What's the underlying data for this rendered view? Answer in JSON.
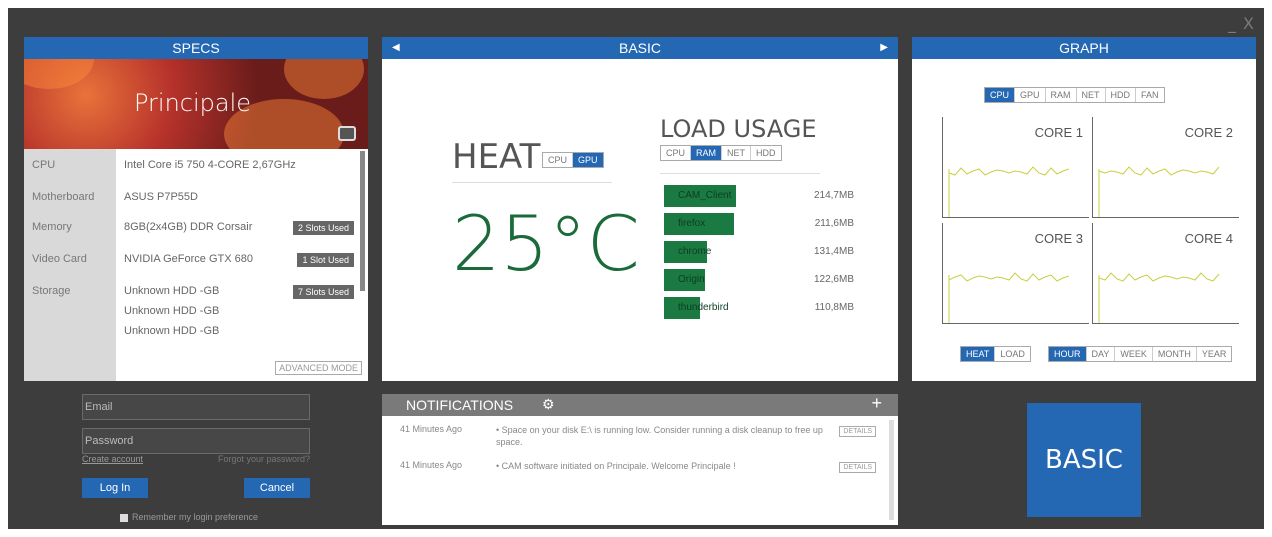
{
  "window": {
    "minimize": "_",
    "close": "X"
  },
  "specs": {
    "title": "SPECS",
    "computer_name": "Principale",
    "rows": [
      {
        "label": "CPU",
        "value": "Intel Core i5 750  4-CORE 2,67GHz"
      },
      {
        "label": "Motherboard",
        "value": "ASUS P7P55D"
      },
      {
        "label": "Memory",
        "value": "8GB(2x4GB) DDR Corsair",
        "badge": "2 Slots Used"
      },
      {
        "label": "Video Card",
        "value": "NVIDIA GeForce GTX 680",
        "badge": "1 Slot Used"
      },
      {
        "label": "Storage",
        "value": "Unknown HDD  -GB",
        "badge": "7 Slots Used"
      },
      {
        "value": "Unknown HDD  -GB"
      },
      {
        "value": "Unknown HDD  -GB"
      }
    ],
    "advanced_mode": "ADVANCED MODE"
  },
  "basic": {
    "title": "BASIC",
    "heat": {
      "title": "HEAT",
      "toggles": [
        "CPU",
        "GPU"
      ],
      "active": "GPU",
      "value": "25°C"
    },
    "load": {
      "title": "LOAD USAGE",
      "toggles": [
        "CPU",
        "RAM",
        "NET",
        "HDD"
      ],
      "active": "RAM",
      "processes": [
        {
          "name": "CAM_Client",
          "value": "214,7MB",
          "fraction": 0.4
        },
        {
          "name": "firefox",
          "value": "211,6MB",
          "fraction": 0.39
        },
        {
          "name": "chrome",
          "value": "131,4MB",
          "fraction": 0.24
        },
        {
          "name": "Origin",
          "value": "122,6MB",
          "fraction": 0.23
        },
        {
          "name": "thunderbird",
          "value": "110,8MB",
          "fraction": 0.2
        }
      ]
    }
  },
  "graph": {
    "title": "GRAPH",
    "tabs": [
      "CPU",
      "GPU",
      "RAM",
      "NET",
      "HDD",
      "FAN"
    ],
    "active_tab": "CPU",
    "cores": [
      "CORE 1",
      "CORE 2",
      "CORE 3",
      "CORE 4"
    ],
    "mode_toggles": [
      "HEAT",
      "LOAD"
    ],
    "active_mode": "HEAT",
    "ranges": [
      "HOUR",
      "DAY",
      "WEEK",
      "MONTH",
      "YEAR"
    ],
    "active_range": "HOUR"
  },
  "login": {
    "email_placeholder": "Email",
    "password_placeholder": "Password",
    "create_account": "Create account",
    "forgot_password": "Forgot your password?",
    "login_button": "Log In",
    "cancel_button": "Cancel",
    "remember": "Remember my login preference"
  },
  "notifications": {
    "title": "NOTIFICATIONS",
    "items": [
      {
        "ago": "41 Minutes Ago",
        "message": "•  Space on your disk E:\\ is running low. Consider running a disk cleanup to free up space.",
        "details": "DETAILS"
      },
      {
        "ago": "41 Minutes Ago",
        "message": "•  CAM software initiated on Principale. Welcome Principale !",
        "details": "DETAILS"
      }
    ]
  },
  "mode_button": "BASIC",
  "colors": {
    "accent": "#2468b4",
    "bar": "#1a7a42",
    "chart_line": "#c8d040"
  }
}
